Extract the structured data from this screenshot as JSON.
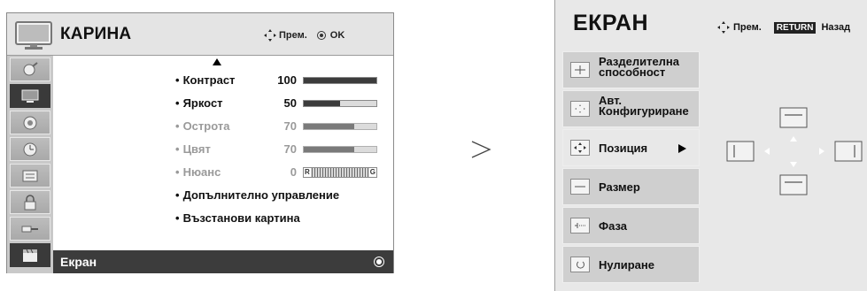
{
  "left_menu": {
    "title": "КАРИНА",
    "hint_move": "Прем.",
    "hint_ok": "OK",
    "rows": [
      {
        "label": "Контраст",
        "value": "100",
        "level": 100,
        "dim": false
      },
      {
        "label": "Яркост",
        "value": "50",
        "level": 50,
        "dim": false
      },
      {
        "label": "Острота",
        "value": "70",
        "level": 70,
        "dim": true
      },
      {
        "label": "Цвят",
        "value": "70",
        "level": 70,
        "dim": true
      },
      {
        "label": "Нюанс",
        "value": "0",
        "dim": true,
        "tint_left": "R",
        "tint_right": "G"
      },
      {
        "label": "Допълнително управление",
        "dim": false
      },
      {
        "label": "Възстанови картина",
        "dim": false
      }
    ],
    "selected_item": "Екран",
    "sidebar_icons": [
      "satellite-icon",
      "tv-icon",
      "speaker-icon",
      "clock-icon",
      "lock-list-icon",
      "padlock-icon",
      "input-plug-icon",
      "film-clapper-icon"
    ]
  },
  "right_menu": {
    "title": "ЕКРАН",
    "hint_move": "Прем.",
    "return_badge": "RETURN",
    "hint_back": "Назад",
    "items": [
      {
        "label_line1": "Разделителна",
        "label_line2": "способност",
        "icon": "plus-icon"
      },
      {
        "label_line1": "Авт.",
        "label_line2": "Конфигуриране",
        "icon": "auto-config-icon"
      },
      {
        "label": "Позиция",
        "icon": "position-arrows-icon",
        "active": true
      },
      {
        "label": "Размер",
        "icon": "size-icon"
      },
      {
        "label": "Фаза",
        "icon": "phase-icon"
      },
      {
        "label": "Нулиране",
        "icon": "reset-icon"
      }
    ]
  },
  "colors": {
    "panel_bg": "#e4e4e4",
    "selected_bg": "#3c3c3c",
    "bar_fill": "#3c3c3c"
  }
}
